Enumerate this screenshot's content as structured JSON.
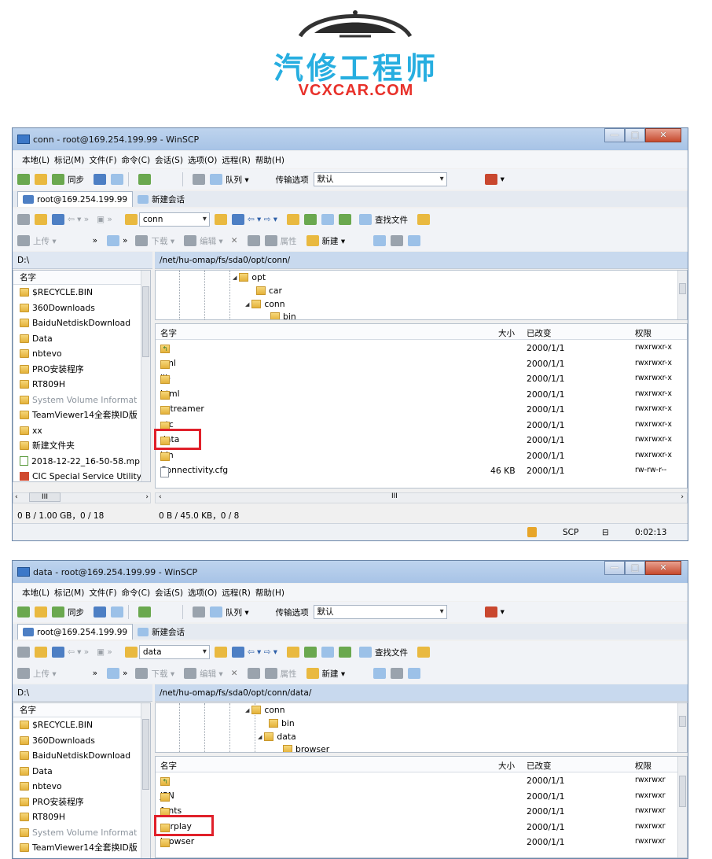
{
  "logo": {
    "title_cn": "汽修工程师",
    "domain": "VCXCAR.COM"
  },
  "colors": {
    "logo_blue": "#27aee0",
    "logo_red": "#e8312a",
    "highlight": "#e0202a",
    "titlebar": "#a7c3e6"
  },
  "menu": [
    "本地(L)",
    "标记(M)",
    "文件(F)",
    "命令(C)",
    "会话(S)",
    "选项(O)",
    "远程(R)",
    "帮助(H)"
  ],
  "toolbar": {
    "sync": "同步",
    "queue": "队列 ▾",
    "transfer_options": "传输选项",
    "transfer_default": "默认",
    "upload": "上传 ▾",
    "download": "下载 ▾",
    "edit": "编辑 ▾",
    "properties": "属性",
    "new": "新建 ▾",
    "find_files": "查找文件"
  },
  "session": {
    "active": "root@169.254.199.99",
    "new_session": "新建会话"
  },
  "left_panel": {
    "path": "D:\\",
    "column": "名字",
    "items": [
      {
        "name": "$RECYCLE.BIN",
        "icon": "folder-icon",
        "gray": false
      },
      {
        "name": "360Downloads",
        "icon": "folder-icon",
        "gray": false
      },
      {
        "name": "BaiduNetdiskDownload",
        "icon": "folder-icon",
        "gray": false
      },
      {
        "name": "Data",
        "icon": "folder-icon",
        "gray": false
      },
      {
        "name": "nbtevo",
        "icon": "folder-icon",
        "gray": false
      },
      {
        "name": "PRO安装程序",
        "icon": "folder-icon",
        "gray": false
      },
      {
        "name": "RT809H",
        "icon": "folder-icon",
        "gray": false
      },
      {
        "name": "System Volume Informat",
        "icon": "folder-icon",
        "gray": true
      },
      {
        "name": "TeamViewer14全套换ID版",
        "icon": "folder-icon",
        "gray": false
      },
      {
        "name": "xx",
        "icon": "folder-icon",
        "gray": false
      },
      {
        "name": "新建文件夹",
        "icon": "folder-icon",
        "gray": false
      },
      {
        "name": "2018-12-22_16-50-58.mp",
        "icon": "video-file-icon",
        "gray": false
      },
      {
        "name": "CIC Special Service Utility",
        "icon": "app-icon",
        "gray": false
      }
    ],
    "status": "0 B / 1.00 GB，0 / 18",
    "hscroll_label": "III"
  },
  "window1": {
    "title": "conn - root@169.254.199.99 - WinSCP",
    "combo": "conn",
    "remote_path": "/net/hu-omap/fs/sda0/opt/conn/",
    "tree": [
      "opt",
      "car",
      "conn",
      "bin"
    ],
    "columns": {
      "name": "名字",
      "size": "大小",
      "changed": "已改变",
      "rights": "权限"
    },
    "files": [
      {
        "name": "..",
        "size": "",
        "changed": "2000/1/1",
        "rights": "rwxrwxr-x",
        "type": "up"
      },
      {
        "name": "xml",
        "size": "",
        "changed": "2000/1/1",
        "rights": "rwxrwxr-x",
        "type": "folder"
      },
      {
        "name": "lib",
        "size": "",
        "changed": "2000/1/1",
        "rights": "rwxrwxr-x",
        "type": "folder"
      },
      {
        "name": "html",
        "size": "",
        "changed": "2000/1/1",
        "rights": "rwxrwxr-x",
        "type": "folder"
      },
      {
        "name": "gstreamer",
        "size": "",
        "changed": "2000/1/1",
        "rights": "rwxrwxr-x",
        "type": "folder"
      },
      {
        "name": "etc",
        "size": "",
        "changed": "2000/1/1",
        "rights": "rwxrwxr-x",
        "type": "folder"
      },
      {
        "name": "data",
        "size": "",
        "changed": "2000/1/1",
        "rights": "rwxrwxr-x",
        "type": "folder"
      },
      {
        "name": "bin",
        "size": "",
        "changed": "2000/1/1",
        "rights": "rwxrwxr-x",
        "type": "folder"
      },
      {
        "name": "Connectivity.cfg",
        "size": "46 KB",
        "changed": "2000/1/1",
        "rights": "rw-rw-r--",
        "type": "file"
      }
    ],
    "status": "0 B / 45.0 KB，0 / 8",
    "protocol": "SCP",
    "elapsed": "0:02:13"
  },
  "window2": {
    "title": "data - root@169.254.199.99 - WinSCP",
    "combo": "data",
    "remote_path": "/net/hu-omap/fs/sda0/opt/conn/data/",
    "tree": [
      "conn",
      "bin",
      "data",
      "browser"
    ],
    "files": [
      {
        "name": "..",
        "changed": "2000/1/1",
        "rights": "rwxrwxr",
        "type": "up"
      },
      {
        "name": "JPN",
        "changed": "2000/1/1",
        "rights": "rwxrwxr",
        "type": "folder"
      },
      {
        "name": "fonts",
        "changed": "2000/1/1",
        "rights": "rwxrwxr",
        "type": "folder"
      },
      {
        "name": "carplay",
        "changed": "2000/1/1",
        "rights": "rwxrwxr",
        "type": "folder"
      },
      {
        "name": "browser",
        "changed": "2000/1/1",
        "rights": "rwxrwxr",
        "type": "folder"
      }
    ]
  }
}
